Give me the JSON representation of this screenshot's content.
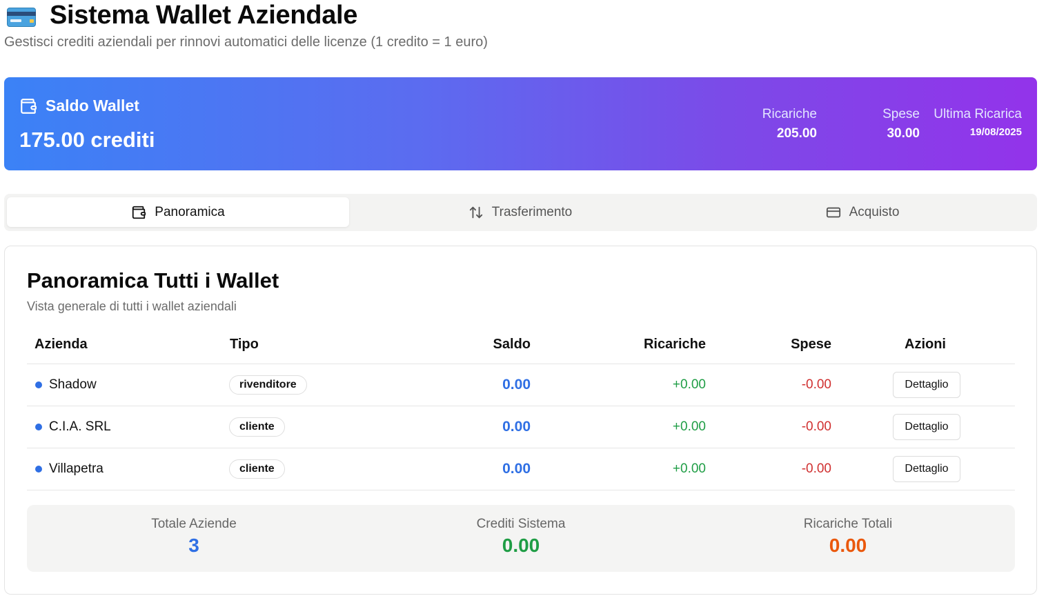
{
  "header": {
    "title": "Sistema Wallet Aziendale",
    "subtitle": "Gestisci crediti aziendali per rinnovi automatici delle licenze (1 credito = 1 euro)"
  },
  "balance": {
    "label": "Saldo Wallet",
    "amount": "175.00 crediti",
    "stats": {
      "ricariche": {
        "label": "Ricariche",
        "value": "205.00"
      },
      "spese": {
        "label": "Spese",
        "value": "30.00"
      },
      "ultima": {
        "label": "Ultima Ricarica",
        "value": "19/08/2025"
      }
    }
  },
  "tabs": [
    {
      "label": "Panoramica",
      "icon": "wallet-icon",
      "active": true
    },
    {
      "label": "Trasferimento",
      "icon": "arrows-up-down-icon",
      "active": false
    },
    {
      "label": "Acquisto",
      "icon": "credit-card-icon",
      "active": false
    }
  ],
  "overview": {
    "title": "Panoramica Tutti i Wallet",
    "subtitle": "Vista generale di tutti i wallet aziendali",
    "columns": [
      "Azienda",
      "Tipo",
      "Saldo",
      "Ricariche",
      "Spese",
      "Azioni"
    ],
    "rows": [
      {
        "azienda": "Shadow",
        "tipo": "rivenditore",
        "saldo": "0.00",
        "ricariche": "+0.00",
        "spese": "-0.00",
        "azione": "Dettaglio"
      },
      {
        "azienda": "C.I.A. SRL",
        "tipo": "cliente",
        "saldo": "0.00",
        "ricariche": "+0.00",
        "spese": "-0.00",
        "azione": "Dettaglio"
      },
      {
        "azienda": "Villapetra",
        "tipo": "cliente",
        "saldo": "0.00",
        "ricariche": "+0.00",
        "spese": "-0.00",
        "azione": "Dettaglio"
      }
    ],
    "summary": {
      "totale_aziende": {
        "label": "Totale Aziende",
        "value": "3"
      },
      "crediti_sistema": {
        "label": "Crediti Sistema",
        "value": "0.00"
      },
      "ricariche_totali": {
        "label": "Ricariche Totali",
        "value": "0.00"
      }
    }
  },
  "colors": {
    "gradient_start": "#3b82f6",
    "gradient_end": "#9333ea",
    "saldo_blue": "#2f6fe4",
    "positive_green": "#1f9d45",
    "negative_red": "#d03030",
    "orange": "#ea580c"
  }
}
